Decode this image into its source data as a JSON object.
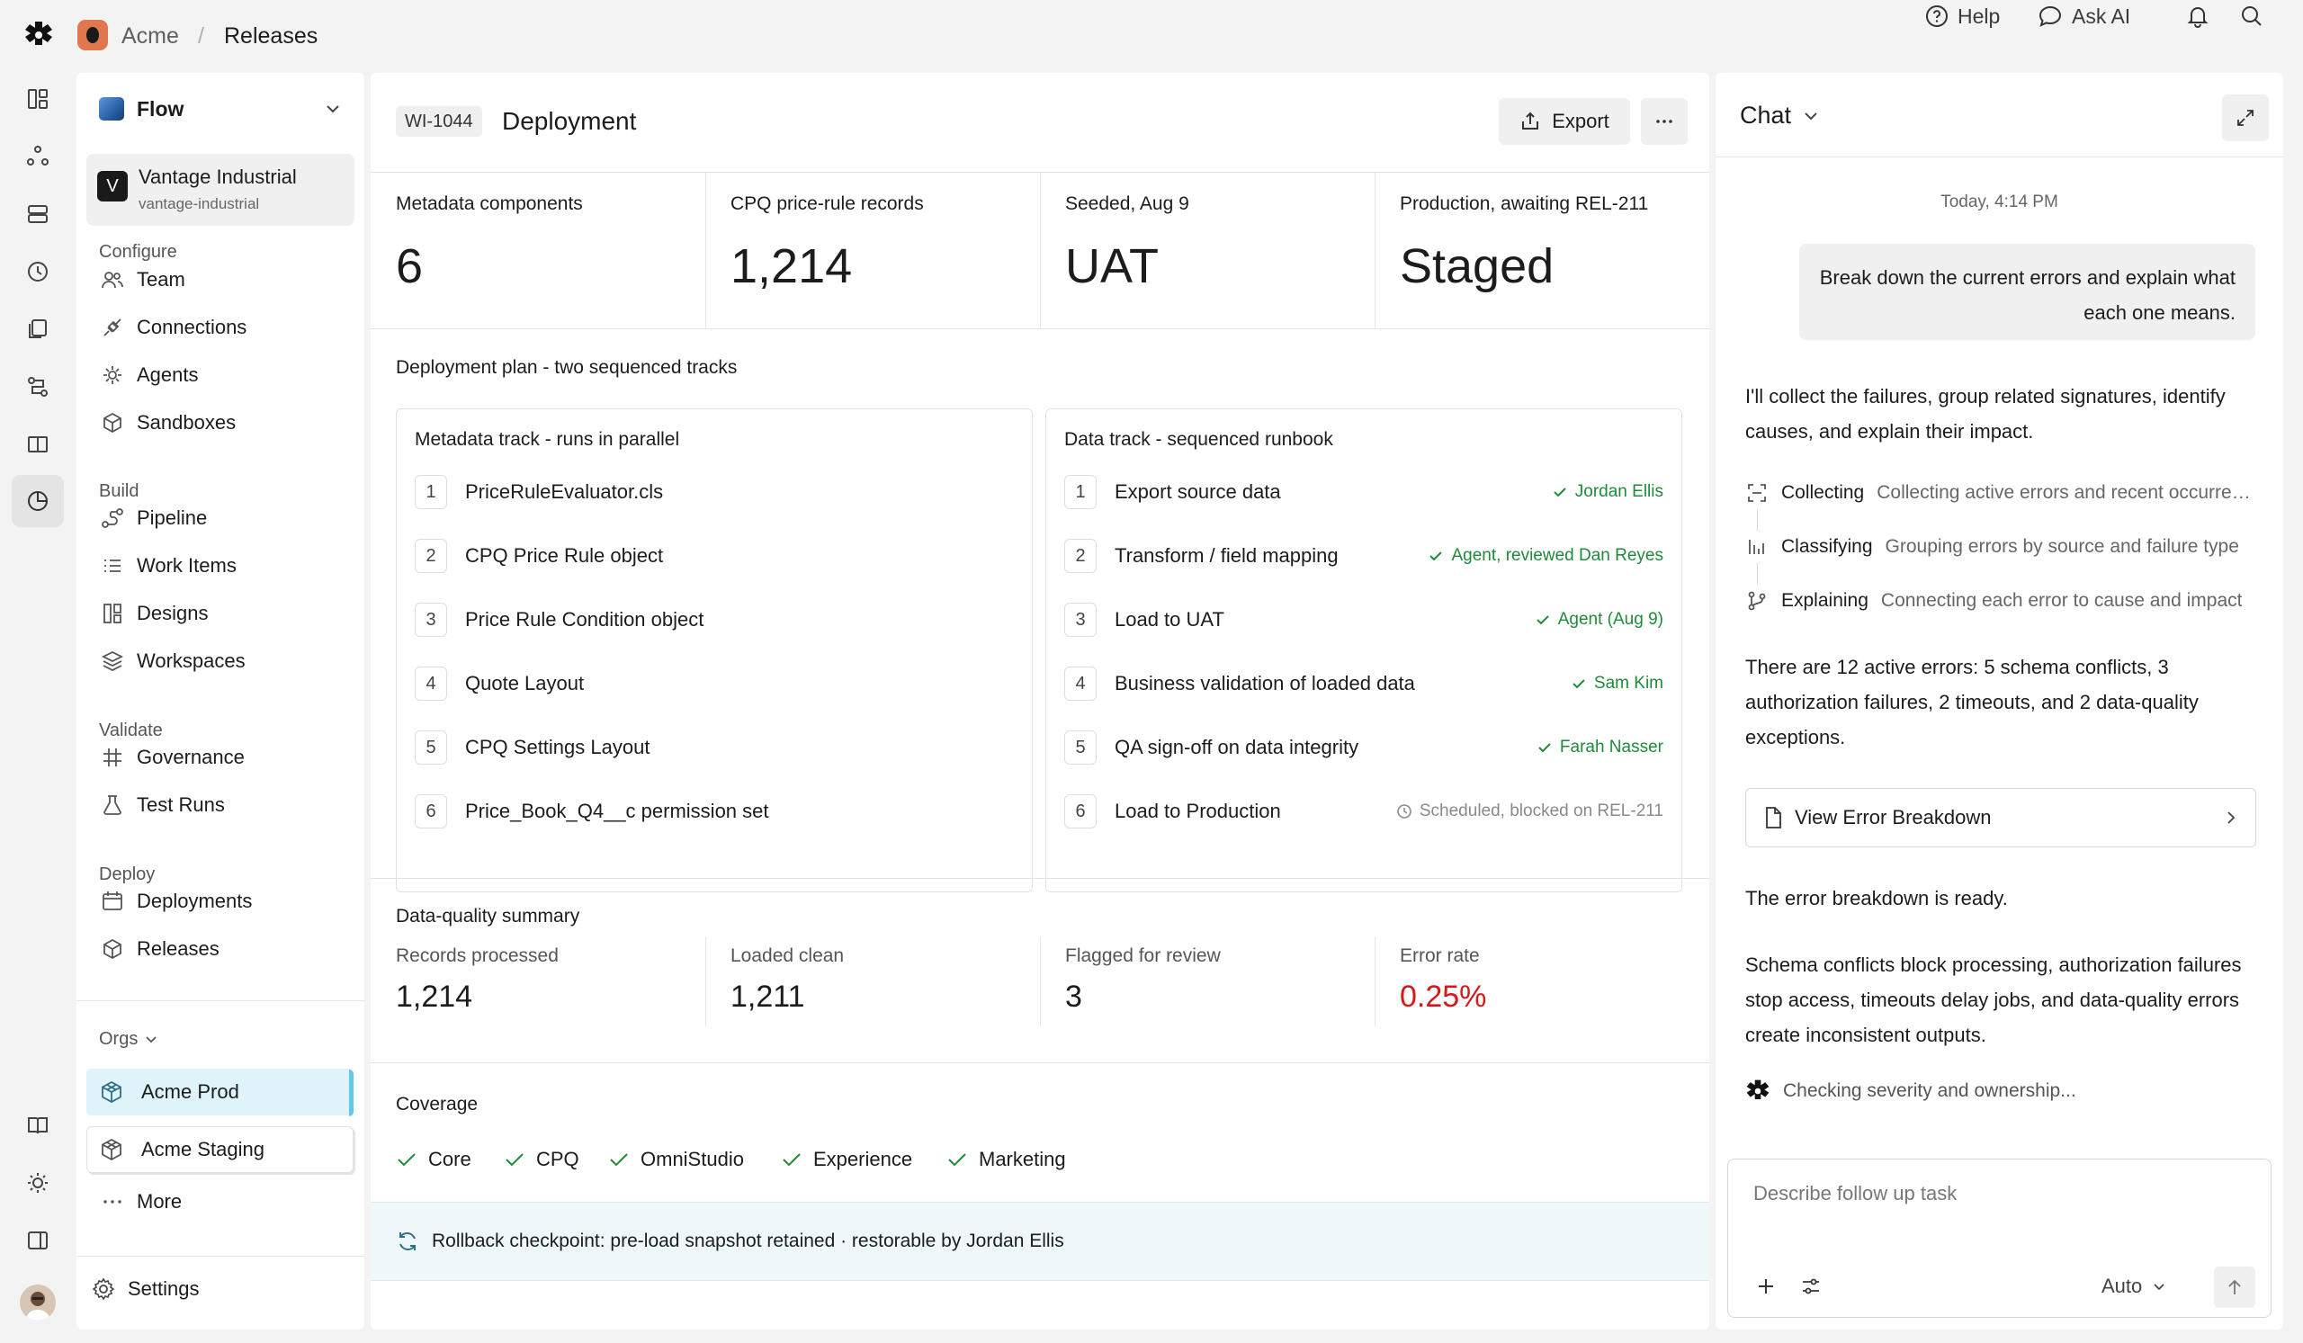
{
  "breadcrumb": {
    "workspace": "Acme",
    "separator": "/",
    "page": "Releases"
  },
  "top_actions": {
    "help": "Help",
    "ask_ai": "Ask AI"
  },
  "nav": {
    "selector": "Flow",
    "org": {
      "initial": "V",
      "name": "Vantage Industrial",
      "slug": "vantage-industrial"
    },
    "sections": {
      "configure": "Configure",
      "build": "Build",
      "validate": "Validate",
      "deploy": "Deploy"
    },
    "items": {
      "team": "Team",
      "connections": "Connections",
      "agents": "Agents",
      "sandboxes": "Sandboxes",
      "pipeline": "Pipeline",
      "work_items": "Work Items",
      "designs": "Designs",
      "workspaces": "Workspaces",
      "governance": "Governance",
      "test_runs": "Test Runs",
      "deployments": "Deployments",
      "releases": "Releases"
    },
    "orgs_label": "Orgs",
    "orgs": {
      "prod": "Acme Prod",
      "staging": "Acme Staging"
    },
    "more": "More",
    "settings": "Settings"
  },
  "main": {
    "work_item_id": "WI-1044",
    "title": "Deployment",
    "export_label": "Export",
    "stats": [
      {
        "label": "Metadata components",
        "value": "6"
      },
      {
        "label": "CPQ price-rule records",
        "value": "1,214"
      },
      {
        "label": "Seeded, Aug 9",
        "value": "UAT"
      },
      {
        "label": "Production, awaiting REL-211",
        "value": "Staged"
      }
    ],
    "plan_title": "Deployment plan - two sequenced tracks",
    "metadata_track": {
      "title": "Metadata track - runs in parallel",
      "steps": [
        {
          "num": "1",
          "label": "PriceRuleEvaluator.cls"
        },
        {
          "num": "2",
          "label": "CPQ Price Rule object"
        },
        {
          "num": "3",
          "label": "Price Rule Condition object"
        },
        {
          "num": "4",
          "label": "Quote Layout"
        },
        {
          "num": "5",
          "label": "CPQ Settings Layout"
        },
        {
          "num": "6",
          "label": "Price_Book_Q4__c permission set"
        }
      ]
    },
    "data_track": {
      "title": "Data track - sequenced runbook",
      "steps": [
        {
          "num": "1",
          "label": "Export source data",
          "status": "Jordan Ellis"
        },
        {
          "num": "2",
          "label": "Transform / field mapping",
          "status": "Agent, reviewed Dan Reyes"
        },
        {
          "num": "3",
          "label": "Load to UAT",
          "status": "Agent (Aug 9)"
        },
        {
          "num": "4",
          "label": "Business validation of loaded data",
          "status": "Sam Kim"
        },
        {
          "num": "5",
          "label": "QA sign-off on data integrity",
          "status": "Farah Nasser"
        },
        {
          "num": "6",
          "label": "Load to Production",
          "status": "Scheduled, blocked on REL-211"
        }
      ]
    },
    "data_quality": {
      "title": "Data-quality summary",
      "metrics": [
        {
          "label": "Records processed",
          "value": "1,214"
        },
        {
          "label": "Loaded clean",
          "value": "1,211"
        },
        {
          "label": "Flagged for review",
          "value": "3"
        },
        {
          "label": "Error rate",
          "value": "0.25%"
        }
      ]
    },
    "coverage": {
      "title": "Coverage",
      "items": [
        "Core",
        "CPQ",
        "OmniStudio",
        "Experience",
        "Marketing"
      ]
    },
    "rollback": "Rollback checkpoint: pre-load snapshot retained · restorable by Jordan Ellis"
  },
  "chat": {
    "title": "Chat",
    "timestamp": "Today, 4:14 PM",
    "user_message": "Break down the current errors and explain what each one means.",
    "assistant_intro": "I'll collect the failures, group related signatures, identify causes, and explain their impact.",
    "tools": [
      {
        "name": "Collecting",
        "desc": "Collecting active errors and recent occurrences"
      },
      {
        "name": "Classifying",
        "desc": "Grouping errors by source and failure type"
      },
      {
        "name": "Explaining",
        "desc": "Connecting each error to cause and impact"
      }
    ],
    "summary": "There are 12 active errors: 5 schema conflicts, 3 authorization failures, 2 timeouts, and 2 data-quality exceptions.",
    "breakdown_card": "View Error Breakdown",
    "ready": "The error breakdown is ready.",
    "explanation": "Schema conflicts block processing, authorization failures stop access, timeouts delay jobs, and data-quality errors create inconsistent outputs.",
    "checking": "Checking severity and ownership...",
    "input_placeholder": "Describe follow up task",
    "mode": "Auto"
  },
  "colors": {
    "success": "#1f8a3a",
    "error": "#d11a1a",
    "active_org": "#dff3fb",
    "accent": "#65c6e8"
  }
}
